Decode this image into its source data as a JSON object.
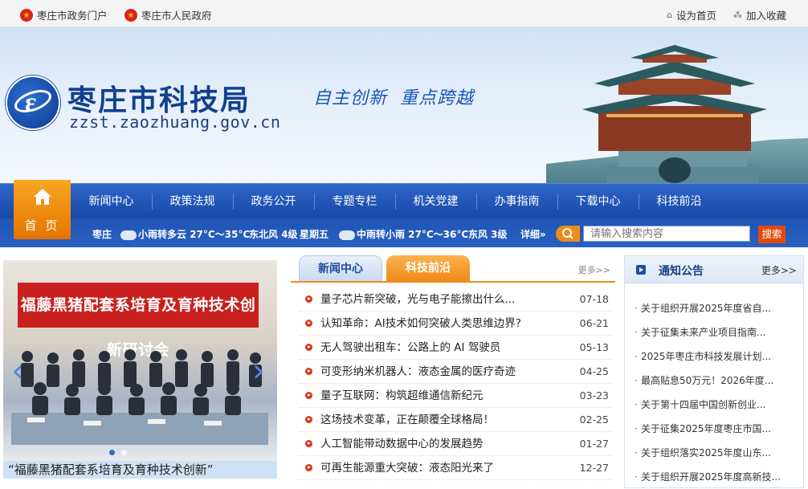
{
  "topbar": {
    "portal_link": "枣庄市政务门户",
    "gov_link": "枣庄市人民政府",
    "set_home": "设为首页",
    "favorite": "加入收藏"
  },
  "header": {
    "site_name": "枣庄市科技局",
    "domain": "zzst.zaozhuang.gov.cn",
    "slogan": "自主创新  重点跨越"
  },
  "nav": {
    "home": "首 页",
    "items": [
      "新闻中心",
      "政策法规",
      "政务公开",
      "专题专栏",
      "机关党建",
      "办事指南",
      "下载中心",
      "科技前沿"
    ]
  },
  "weather": {
    "city": "枣庄",
    "day1": "小雨转多云 27°C～35°C",
    "wind1": "东北风 4级",
    "weekday": "星期五",
    "day2": "中雨转小雨 27°C～36°C",
    "wind2": "东风 3级",
    "detail": "详细»"
  },
  "search": {
    "placeholder": "请输入搜索内容",
    "button": "搜索"
  },
  "slideshow": {
    "banner_text": "福藤黑猪配套系培育及育种技术创新研讨会",
    "caption": "“福藤黑猪配套系培育及育种技术创新”"
  },
  "news_tabs": {
    "tab1": "新闻中心",
    "tab2": "科技前沿",
    "more": "更多>>"
  },
  "news": [
    {
      "title": "量子芯片新突破，光与电子能擦出什么...",
      "date": "07-18"
    },
    {
      "title": "认知革命：AI技术如何突破人类思维边界?",
      "date": "06-21"
    },
    {
      "title": "无人驾驶出租车：公路上的 AI 驾驶员",
      "date": "05-13"
    },
    {
      "title": "可变形纳米机器人：液态金属的医疗奇迹",
      "date": "04-25"
    },
    {
      "title": "量子互联网：构筑超维通信新纪元",
      "date": "03-23"
    },
    {
      "title": "这场技术变革，正在颠覆全球格局！",
      "date": "02-25"
    },
    {
      "title": "人工智能带动数据中心的发展趋势",
      "date": "01-27"
    },
    {
      "title": "可再生能源重大突破：液态阳光来了",
      "date": "12-27"
    }
  ],
  "notice": {
    "title": "通知公告",
    "more": "更多>>",
    "items": [
      "关于组织开展2025年度省自...",
      "关于征集未来产业项目指南...",
      "2025年枣庄市科技发展计划...",
      "最高贴息50万元！2026年度...",
      "关于第十四届中国创新创业...",
      "关于征集2025年度枣庄市国...",
      "关于组织落实2025年度山东...",
      "关于组织开展2025年度高新技..."
    ]
  },
  "colors": {
    "nav_blue": "#1e54b5",
    "accent_orange": "#ef8a17",
    "title_blue": "#123f8f"
  }
}
